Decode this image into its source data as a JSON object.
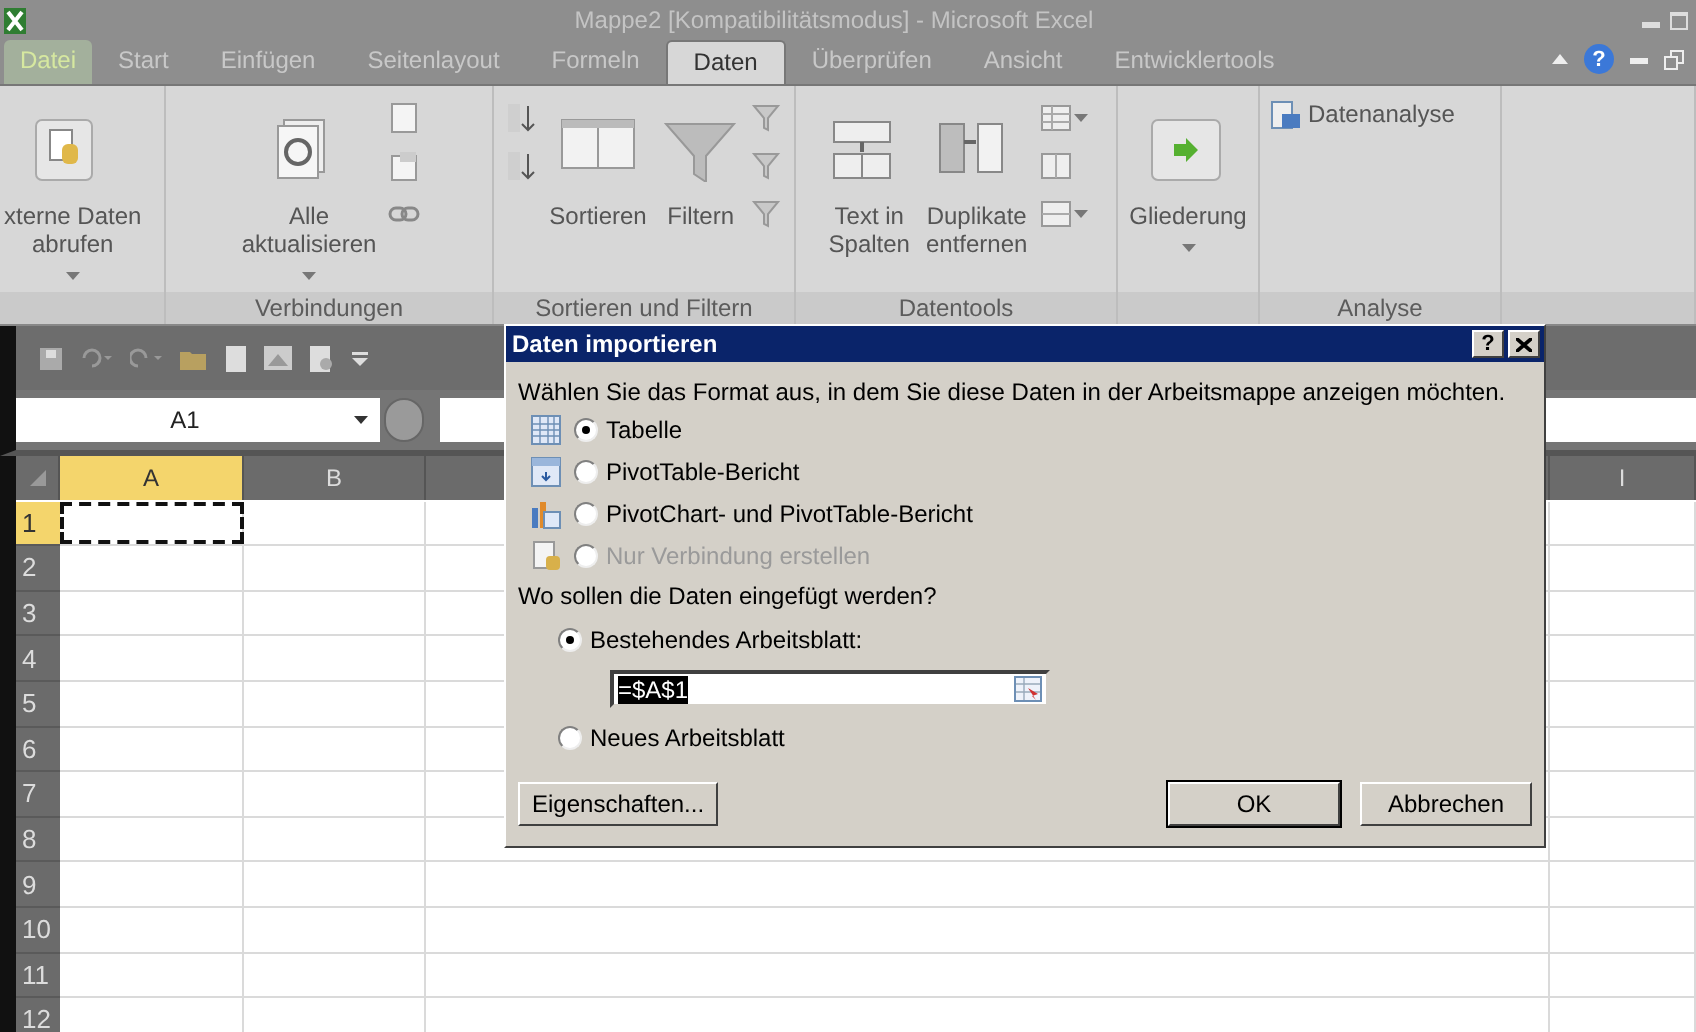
{
  "window": {
    "title": "Mappe2  [Kompatibilitätsmodus]  -  Microsoft Excel"
  },
  "ribbon_tabs": [
    {
      "label": "Datei",
      "selected": false,
      "kind": "file"
    },
    {
      "label": "Start",
      "selected": false,
      "kind": "tab"
    },
    {
      "label": "Einfügen",
      "selected": false,
      "kind": "tab"
    },
    {
      "label": "Seitenlayout",
      "selected": false,
      "kind": "tab"
    },
    {
      "label": "Formeln",
      "selected": false,
      "kind": "tab"
    },
    {
      "label": "Daten",
      "selected": true,
      "kind": "tab"
    },
    {
      "label": "Überprüfen",
      "selected": false,
      "kind": "tab"
    },
    {
      "label": "Ansicht",
      "selected": false,
      "kind": "tab"
    },
    {
      "label": "Entwicklertools",
      "selected": false,
      "kind": "tab"
    }
  ],
  "help_button": "?",
  "ribbon_groups": [
    {
      "buttons": [
        {
          "kind": "large",
          "lines": [
            "xterne Daten",
            "abrufen"
          ],
          "dropdown": true
        }
      ]
    },
    {
      "label": "Verbindungen",
      "buttons": [
        {
          "kind": "large",
          "lines": [
            "Alle",
            "aktualisieren"
          ],
          "dropdown": true
        },
        {
          "kind": "stack",
          "buttons": [
            {
              "kind": "icon",
              "dropdown": false
            },
            {
              "kind": "icon",
              "dropdown": false
            },
            {
              "kind": "icon",
              "dropdown": false
            }
          ]
        }
      ]
    },
    {
      "label": "Sortieren und Filtern",
      "buttons": [
        {
          "kind": "stack",
          "buttons": [
            {
              "kind": "icon",
              "dropdown": false
            },
            {
              "kind": "icon",
              "dropdown": false
            }
          ]
        },
        {
          "kind": "large",
          "lines": [
            "Sortieren"
          ],
          "dropdown": false
        },
        {
          "kind": "large",
          "lines": [
            "Filtern"
          ],
          "dropdown": false
        },
        {
          "kind": "stack",
          "buttons": [
            {
              "kind": "icon",
              "dropdown": false
            },
            {
              "kind": "icon",
              "dropdown": false
            },
            {
              "kind": "icon",
              "dropdown": false
            }
          ]
        }
      ]
    },
    {
      "label": "Datentools",
      "buttons": [
        {
          "kind": "large",
          "lines": [
            "Text in",
            "Spalten"
          ],
          "dropdown": false
        },
        {
          "kind": "large",
          "lines": [
            "Duplikate",
            "entfernen"
          ],
          "dropdown": false
        },
        {
          "kind": "stack",
          "buttons": [
            {
              "kind": "icon",
              "dropdown": true
            },
            {
              "kind": "icon",
              "dropdown": false
            },
            {
              "kind": "icon",
              "dropdown": true
            }
          ]
        }
      ]
    },
    {
      "buttons": [
        {
          "kind": "large",
          "lines": [
            "Gliederung"
          ],
          "dropdown": true
        }
      ]
    },
    {
      "label": "Analyse",
      "buttons": [
        {
          "kind": "small",
          "label": "Datenanalyse"
        }
      ]
    }
  ],
  "name_box": {
    "value": "A1"
  },
  "sheet": {
    "columns": [
      {
        "label": "A",
        "selected": true
      },
      {
        "label": "B",
        "selected": false
      },
      {
        "label": "I",
        "selected": false
      }
    ],
    "rows": [
      {
        "label": "1",
        "selected": true
      },
      {
        "label": "2",
        "selected": false
      },
      {
        "label": "3",
        "selected": false
      },
      {
        "label": "4",
        "selected": false
      },
      {
        "label": "5",
        "selected": false
      },
      {
        "label": "6",
        "selected": false
      },
      {
        "label": "7",
        "selected": false
      },
      {
        "label": "8",
        "selected": false
      },
      {
        "label": "9",
        "selected": false
      },
      {
        "label": "10",
        "selected": false
      },
      {
        "label": "11",
        "selected": false
      },
      {
        "label": "12",
        "selected": false
      }
    ]
  },
  "dialog": {
    "title": "Daten importieren",
    "help_button": "?",
    "prompt": "Wählen Sie das Format aus, in dem Sie diese Daten in der Arbeitsmappe anzeigen möchten.",
    "format_options": [
      {
        "label": "Tabelle",
        "selected": true,
        "disabled": false
      },
      {
        "label": "PivotTable-Bericht",
        "selected": false,
        "disabled": false
      },
      {
        "label": "PivotChart- und PivotTable-Bericht",
        "selected": false,
        "disabled": false
      },
      {
        "label": "Nur Verbindung erstellen",
        "selected": false,
        "disabled": true
      }
    ],
    "location_prompt": "Wo sollen die Daten eingefügt werden?",
    "location_options": [
      {
        "label": "Bestehendes Arbeitsblatt:",
        "selected": true,
        "field": {
          "value": "=$A$1",
          "text_selected": true
        }
      },
      {
        "label": "Neues Arbeitsblatt",
        "selected": false
      }
    ],
    "buttons": [
      {
        "label": "Eigenschaften...",
        "default": false
      },
      {
        "label": "OK",
        "default": true
      },
      {
        "label": "Abbrechen",
        "default": false
      }
    ]
  }
}
